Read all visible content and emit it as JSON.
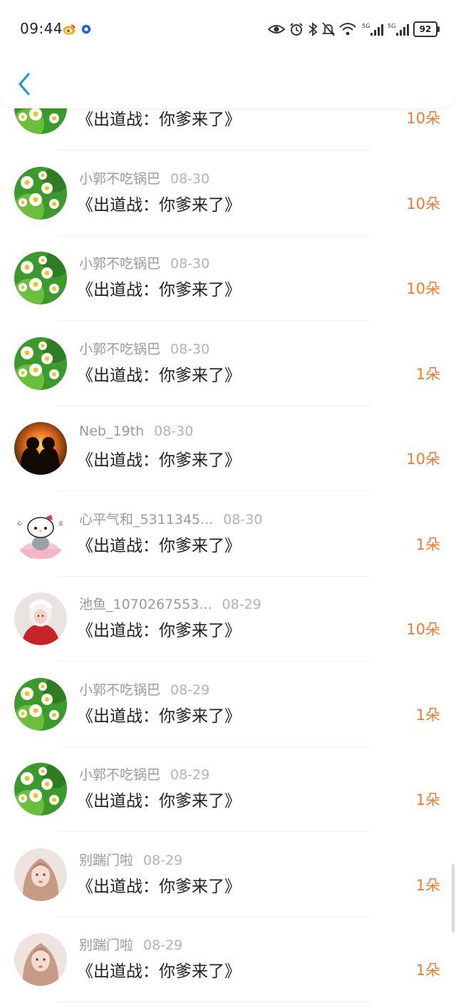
{
  "status_bar": {
    "time": "09:44",
    "battery": "92",
    "icons": [
      "weibo-icon",
      "circle-app-icon",
      "eye-icon",
      "alarm-icon",
      "bluetooth-icon",
      "mute-icon",
      "wifi-icon",
      "signal-5g-icon",
      "signal-5g-icon-2",
      "battery-icon"
    ]
  },
  "header": {
    "back_icon": "chevron-left-icon"
  },
  "colors": {
    "accent": "#f07a2e",
    "back": "#2196e8"
  },
  "rows": [
    {
      "user": "",
      "date": "",
      "title": "《出道战：你爹来了》",
      "amount": "10朵",
      "avatar": "daisy"
    },
    {
      "user": "小郭不吃锅巴",
      "date": "08-30",
      "title": "《出道战：你爹来了》",
      "amount": "10朵",
      "avatar": "daisy"
    },
    {
      "user": "小郭不吃锅巴",
      "date": "08-30",
      "title": "《出道战：你爹来了》",
      "amount": "10朵",
      "avatar": "daisy"
    },
    {
      "user": "小郭不吃锅巴",
      "date": "08-30",
      "title": "《出道战：你爹来了》",
      "amount": "1朵",
      "avatar": "daisy"
    },
    {
      "user": "Neb_19th",
      "date": "08-30",
      "title": "《出道战：你爹来了》",
      "amount": "10朵",
      "avatar": "sunset"
    },
    {
      "user": "心平气和_5311345...",
      "date": "08-30",
      "title": "《出道战：你爹来了》",
      "amount": "1朵",
      "avatar": "kitty"
    },
    {
      "user": "池鱼_1070267553...",
      "date": "08-29",
      "title": "《出道战：你爹来了》",
      "amount": "10朵",
      "avatar": "girl-red"
    },
    {
      "user": "小郭不吃锅巴",
      "date": "08-29",
      "title": "《出道战：你爹来了》",
      "amount": "1朵",
      "avatar": "daisy"
    },
    {
      "user": "小郭不吃锅巴",
      "date": "08-29",
      "title": "《出道战：你爹来了》",
      "amount": "1朵",
      "avatar": "daisy"
    },
    {
      "user": "别踹门啦",
      "date": "08-29",
      "title": "《出道战：你爹来了》",
      "amount": "1朵",
      "avatar": "portrait"
    },
    {
      "user": "别踹门啦",
      "date": "08-29",
      "title": "《出道战：你爹来了》",
      "amount": "1朵",
      "avatar": "portrait"
    }
  ]
}
